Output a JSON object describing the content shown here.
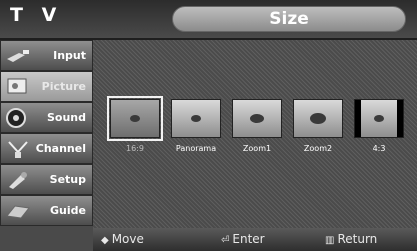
{
  "header": {
    "tv_label": "T V",
    "title": "Size"
  },
  "sidebar": {
    "items": [
      {
        "label": "Input",
        "icon": "input-plug-icon"
      },
      {
        "label": "Picture",
        "icon": "picture-icon",
        "active": true
      },
      {
        "label": "Sound",
        "icon": "speaker-icon"
      },
      {
        "label": "Channel",
        "icon": "antenna-icon"
      },
      {
        "label": "Setup",
        "icon": "setup-icon"
      },
      {
        "label": "Guide",
        "icon": "guide-icon"
      }
    ]
  },
  "size_options": [
    {
      "label": "16:9",
      "selected": true
    },
    {
      "label": "Panorama"
    },
    {
      "label": "Zoom1"
    },
    {
      "label": "Zoom2"
    },
    {
      "label": "4:3"
    }
  ],
  "footer": {
    "move": {
      "icon": "◆",
      "label": "Move"
    },
    "enter": {
      "icon": "⏎",
      "label": "Enter"
    },
    "return": {
      "icon": "▥",
      "label": "Return"
    }
  }
}
